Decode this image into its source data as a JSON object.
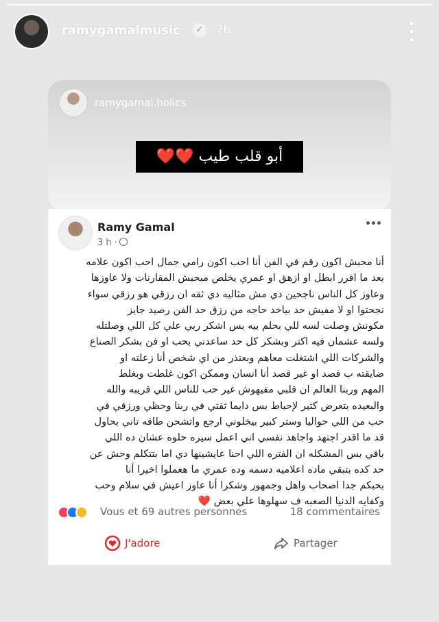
{
  "story": {
    "username": "ramygamalmusic",
    "time": "7h",
    "progress": 1.0
  },
  "card": {
    "username": "ramygamal.holics",
    "quote": "أبو قلب طيب ❤️❤️"
  },
  "post": {
    "author": "Ramy Gamal",
    "time": "3 h ·",
    "lines": [
      "أنا محبش اكون رقم في الفن أنا احب اكون رامي جمال احب اكون علامه",
      "بعد ما اقرر ابطل او ازهق او عمري يخلص مبحبش المقارنات ولا عاوزها",
      "وعاوز كل الناس ناجحين دي مش مثاليه دي ثقه ان رزقي هو رزقي سواء",
      "نجحتوا او لا مفيش حد بياخد حاجه من رزق حد الفن رصيد جايز",
      "مكونش وصلت لسه للي بحلم بيه بس اشكر ربي علي كل اللي وصلتله",
      "ولسه عشمان فيه اكتر وبشكر كل حد ساعدني بحب او فن بشكر الصناع",
      "والشركات اللي اشتغلت معاهم وبعتذر من اي شخص أنا زعلته او",
      "ضايقته ب قصد او غير قصد أنا انسان وممكن اكون غلطت وبغلط",
      "المهم وربنا العالم ان قلبي مفيهوش غير حب للناس اللي قريبه والله",
      "والبعيده بتعرض كتير لإحباط بس دايما ثقتي في ربنا وحظي ورزقي في",
      "حب من اللي حواليا وستر كبير بيخلوني ارجع واتشحن طاقه تاني بحاول",
      "قد ما اقدر اجتهد واجاهد نفسي اني اعمل سيره حلوه عشان ده اللي",
      "باقي بس المشكله ان الفتره اللي احنا عايشينها دي اما بتتكلم وحش عن",
      "حد كده بتبقي ماده اعلاميه دسمه وده عمري ما هعملوا اخيرا أنا",
      "بحبكم جدا اصحاب واهل وجمهور وشكرا أنا عاوز اعيش في سلام وحب",
      "وكفايه الدنيا الصعبه ف سهلوها علي بعض"
    ],
    "end_heart": "❤️",
    "reactions_text": "Vous et 69 autres personnes",
    "comments_text": "18 commentaires",
    "love_label": "J'adore",
    "share_label": "Partager"
  }
}
